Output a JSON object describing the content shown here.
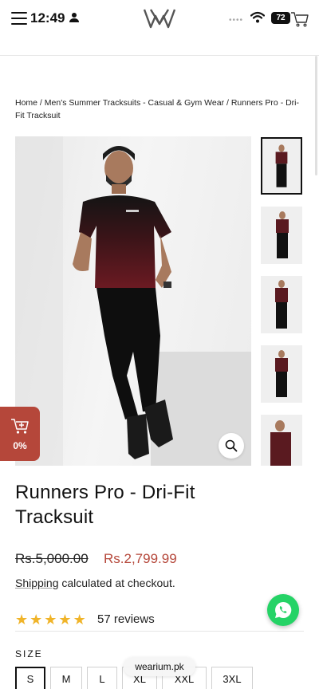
{
  "status_bar": {
    "time": "12:49",
    "battery": "72",
    "icons": [
      "person-icon",
      "wifi-icon",
      "battery-icon"
    ]
  },
  "header": {
    "menu_icon": "hamburger-icon",
    "logo": "wearium-logo",
    "cart_icon": "cart-icon"
  },
  "breadcrumb": {
    "items": [
      "Home",
      "Men's Summer Tracksuits - Casual & Gym Wear",
      "Runners Pro - Dri-Fit Tracksuit"
    ],
    "separator": " / "
  },
  "gallery": {
    "thumbnail_count": 5,
    "active_index": 0,
    "zoom_icon": "zoom-icon"
  },
  "cart_badge": {
    "icon": "cart-plus-icon",
    "percent": "0%"
  },
  "product": {
    "title": "Runners Pro - Dri-Fit Tracksuit",
    "price_old": "Rs.5,000.00",
    "price_new": "Rs.2,799.99",
    "shipping_link": "Shipping",
    "shipping_text": " calculated at checkout.",
    "rating": 5,
    "reviews": "57 reviews"
  },
  "size": {
    "label": "SIZE",
    "options": [
      "S",
      "M",
      "L",
      "XL",
      "XXL",
      "3XL"
    ],
    "selected": "S"
  },
  "url_pill": "wearium.pk",
  "colors": {
    "accent_red": "#b5473a",
    "whatsapp_green": "#25d366",
    "star_gold": "#f0b429"
  }
}
